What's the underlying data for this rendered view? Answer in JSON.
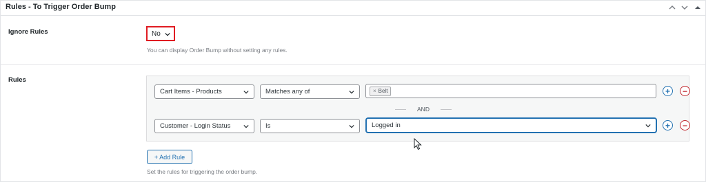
{
  "panel": {
    "title": "Rules - To Trigger Order Bump",
    "collapse_up_icon": "chevron-up-icon",
    "collapse_down_icon": "chevron-down-icon",
    "toggle_icon": "caret-up-icon"
  },
  "ignore_rules": {
    "label": "Ignore Rules",
    "select_value": "No",
    "description": "You can display Order Bump without setting any rules."
  },
  "rules": {
    "label": "Rules",
    "rows": [
      {
        "field": "Cart Items - Products",
        "operator": "Matches any of",
        "tags": [
          {
            "remove": "×",
            "label": "Belt"
          }
        ]
      },
      {
        "field": "Customer - Login Status",
        "operator": "Is",
        "value": "Logged in"
      }
    ],
    "connector": "AND",
    "add_button": "+ Add Rule",
    "description": "Set the rules for triggering the order bump."
  },
  "colors": {
    "accent": "#2271b1",
    "danger": "#c1272d",
    "highlight_border": "#e01b22"
  }
}
